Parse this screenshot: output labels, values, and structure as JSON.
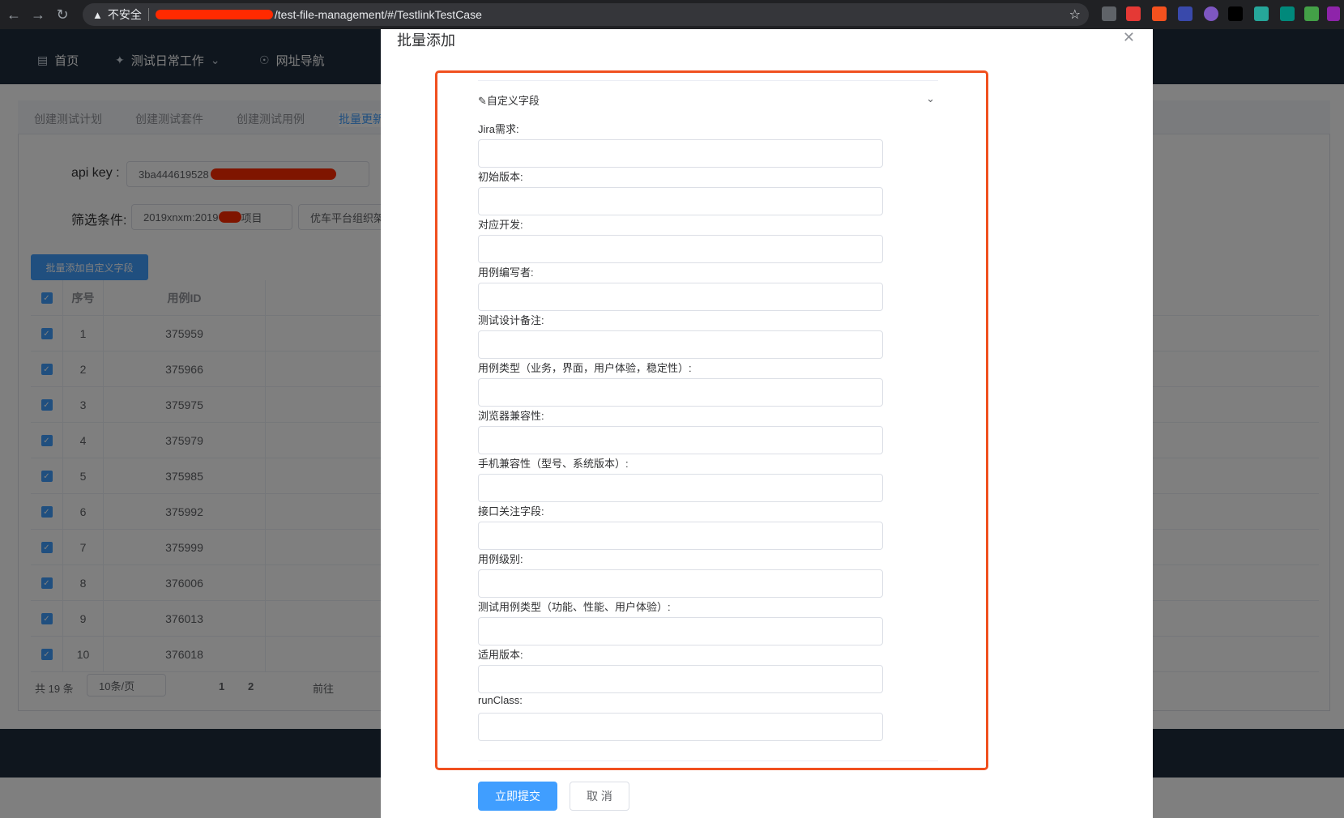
{
  "browser": {
    "security_label": "不安全",
    "url": "/test-file-management/#/TestlinkTestCase"
  },
  "nav": [
    {
      "label": "首页"
    },
    {
      "label": "测试日常工作"
    },
    {
      "label": "网址导航"
    }
  ],
  "tabs": [
    {
      "label": "创建测试计划"
    },
    {
      "label": "创建测试套件"
    },
    {
      "label": "创建测试用例"
    },
    {
      "label": "批量更新"
    }
  ],
  "form": {
    "api_key_label": "api key :",
    "api_key_value": "3ba444619528",
    "filter_label": "筛选条件:",
    "filter_value_prefix": "2019xnxm:2019",
    "filter_value_suffix": "项目",
    "org_select": "优车平台组织架"
  },
  "batch_button": "批量添加自定义字段",
  "table": {
    "columns": [
      "序号",
      "用例ID"
    ],
    "rows": [
      {
        "no": "1",
        "id": "375959"
      },
      {
        "no": "2",
        "id": "375966"
      },
      {
        "no": "3",
        "id": "375975"
      },
      {
        "no": "4",
        "id": "375979"
      },
      {
        "no": "5",
        "id": "375985"
      },
      {
        "no": "6",
        "id": "375992"
      },
      {
        "no": "7",
        "id": "375999"
      },
      {
        "no": "8",
        "id": "376006"
      },
      {
        "no": "9",
        "id": "376013"
      },
      {
        "no": "10",
        "id": "376018"
      }
    ]
  },
  "pagination": {
    "total": "共 19 条",
    "page_size": "10条/页",
    "pages": [
      "1",
      "2"
    ],
    "goto": "前往"
  },
  "dialog": {
    "title": "批量添加",
    "section_title": "自定义字段",
    "fields": [
      {
        "label": "Jira需求:"
      },
      {
        "label": "初始版本:"
      },
      {
        "label": "对应开发:"
      },
      {
        "label": "用例编写者:"
      },
      {
        "label": "测试设计备注:"
      },
      {
        "label": "用例类型（业务，界面，用户体验，稳定性）:"
      },
      {
        "label": "浏览器兼容性:"
      },
      {
        "label": "手机兼容性（型号、系统版本）:"
      },
      {
        "label": "接口关注字段:"
      },
      {
        "label": "用例级别:"
      },
      {
        "label": "测试用例类型（功能、性能、用户体验）:"
      },
      {
        "label": "适用版本:"
      },
      {
        "label": "runClass:"
      }
    ],
    "submit_label": "立即提交",
    "cancel_label": "取 消"
  },
  "colors": {
    "primary": "#409eff",
    "highlight": "#f0501f",
    "header": "#1f2d3d"
  }
}
